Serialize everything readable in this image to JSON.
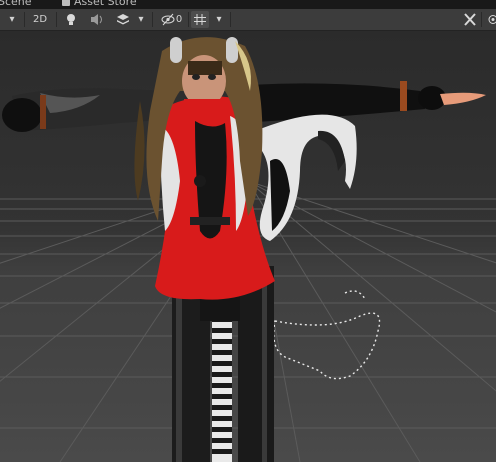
{
  "tabs": [
    {
      "label": "Scene",
      "active": true
    },
    {
      "label": "Asset Store",
      "active": false
    }
  ],
  "toolbar": {
    "mode_2d": "2D",
    "hidden_count": "0",
    "icons": [
      "dropdown-arrow-icon",
      "light-bulb-icon",
      "audio-speaker-icon",
      "effects-layers-icon",
      "dropdown-arrow-icon",
      "visibility-eye-icon",
      "grid-icon",
      "dropdown-arrow-icon",
      "tools-icon",
      "gizmos-icon"
    ]
  },
  "colors": {
    "toolbar_bg": "#3c3c3c",
    "viewport_bg": "#474747",
    "grid_line": "#5a5a5a",
    "outfit_red": "#d81b1b",
    "outfit_black": "#141414"
  }
}
